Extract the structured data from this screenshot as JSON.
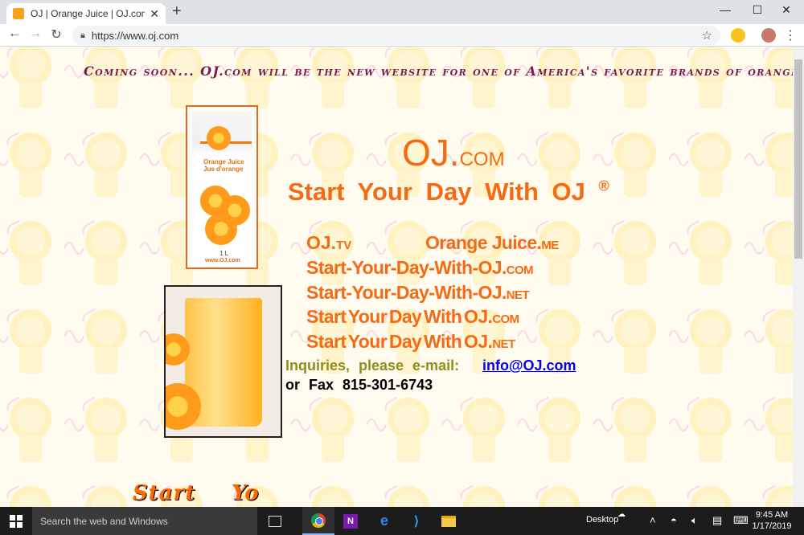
{
  "browser": {
    "tab_title": "OJ | Orange Juice | OJ.com | OJ.tv",
    "tab_close": "✕",
    "new_tab": "+",
    "url": "https://www.oj.com",
    "window_controls": {
      "minimize": "—",
      "maximize": "☐",
      "close": "✕"
    }
  },
  "page": {
    "coming_soon": "Coming soon... OJ.com will be the new website for one of America's favorite brands of orange juice!",
    "carton": {
      "label_line1": "Orange Juice",
      "label_line2": "Jus d'orange",
      "size": "1 L",
      "url": "www.OJ.com"
    },
    "title_main": "OJ.",
    "title_suffix": "COM",
    "tagline": "Start Your Day With OJ",
    "tagline_mark": "®",
    "domains": [
      {
        "main": "OJ.",
        "suffix": "TV"
      },
      {
        "main": "Orange Juice.",
        "suffix": "ME"
      },
      {
        "main": "Start-Your-Day-With-OJ.",
        "suffix": "COM"
      },
      {
        "main": "Start-Your-Day-With-OJ.",
        "suffix": "NET"
      },
      {
        "main": "Start Your Day With OJ.",
        "suffix": "COM"
      },
      {
        "main": "Start Your Day With OJ.",
        "suffix": "NET"
      }
    ],
    "inquiries_label": "Inquiries, please e-mail:",
    "email": "info@OJ.com",
    "fax": "or Fax 815-301-6743",
    "bottom_banner": {
      "start": "Start",
      "yo": "Yo"
    }
  },
  "taskbar": {
    "search_placeholder": "Search the web and Windows",
    "desktop_label": "Desktop",
    "time": "9:45 AM",
    "date": "1/17/2019",
    "onenote_letter": "N"
  },
  "colors": {
    "brand_orange": "#f56a14",
    "coming_soon": "#7a1a52",
    "inquiries": "#8e8e1a",
    "link": "#0000ee"
  }
}
